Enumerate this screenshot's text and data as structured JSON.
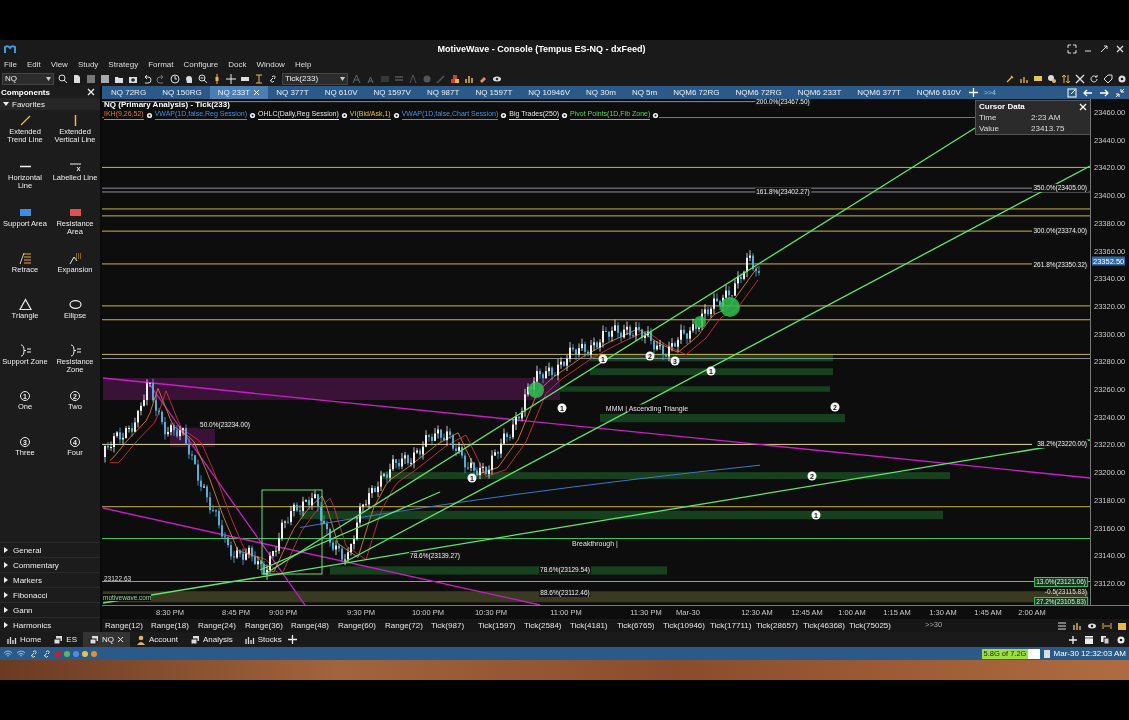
{
  "window": {
    "title": "MotiveWave - Console (Tempus ES-NQ - dxFeed)"
  },
  "menu": [
    "File",
    "Edit",
    "View",
    "Study",
    "Strategy",
    "Format",
    "Configure",
    "Dock",
    "Window",
    "Help"
  ],
  "toolbar": {
    "symbol": "NQ",
    "bar_size": "Tick(233)"
  },
  "chart_tabs": [
    {
      "label": "NQ 72RG",
      "selected": false
    },
    {
      "label": "NQ 150RG",
      "selected": false
    },
    {
      "label": "NQ 233T",
      "selected": true
    },
    {
      "label": "NQ 377T",
      "selected": false
    },
    {
      "label": "NQ 610V",
      "selected": false
    },
    {
      "label": "NQ 1597V",
      "selected": false
    },
    {
      "label": "NQ 987T",
      "selected": false
    },
    {
      "label": "NQ 1597T",
      "selected": false
    },
    {
      "label": "NQ 10946V",
      "selected": false
    },
    {
      "label": "NQ 30m",
      "selected": false
    },
    {
      "label": "NQ 5m",
      "selected": false
    },
    {
      "label": "NQM6 72RG",
      "selected": false
    },
    {
      "label": "NQM6 72RG",
      "selected": false
    },
    {
      "label": "NQM6 233T",
      "selected": false
    },
    {
      "label": "NQM6 377T",
      "selected": false
    },
    {
      "label": "NQM6 610V",
      "selected": false
    }
  ],
  "chart_tabs_overflow": ">>4",
  "components": {
    "title": "Components",
    "favorites": {
      "label": "Favorites",
      "expanded": true,
      "items": [
        {
          "label": "Extended Trend Line",
          "kind": "trend-line"
        },
        {
          "label": "Extended Vertical Line",
          "kind": "vertical-line"
        },
        {
          "label": "Horizontal Line",
          "kind": "horizontal-line"
        },
        {
          "label": "Labelled Line",
          "kind": "labelled-line"
        },
        {
          "label": "Support Area",
          "kind": "support-area"
        },
        {
          "label": "Resistance Area",
          "kind": "resistance-area"
        },
        {
          "label": "Retrace",
          "kind": "retrace"
        },
        {
          "label": "Expansion",
          "kind": "expansion"
        },
        {
          "label": "Triangle",
          "kind": "triangle"
        },
        {
          "label": "Ellipse",
          "kind": "ellipse"
        },
        {
          "label": "Support Zone",
          "kind": "zone"
        },
        {
          "label": "Resistance Zone",
          "kind": "zone"
        },
        {
          "label": "One",
          "kind": "number",
          "symbol": "1"
        },
        {
          "label": "Two",
          "kind": "number",
          "symbol": "2"
        },
        {
          "label": "Three",
          "kind": "number",
          "symbol": "3"
        },
        {
          "label": "Four",
          "kind": "number",
          "symbol": "4"
        }
      ]
    },
    "sections": [
      {
        "label": "General",
        "expanded": false
      },
      {
        "label": "Commentary",
        "expanded": false
      },
      {
        "label": "Markers",
        "expanded": false
      },
      {
        "label": "Fibonacci",
        "expanded": false
      },
      {
        "label": "Gann",
        "expanded": false
      },
      {
        "label": "Harmonics",
        "expanded": false
      }
    ]
  },
  "chart": {
    "title": "NQ (Primary Analysis) - Tick(233)",
    "studies": [
      {
        "label": "IKH(9,26,52)",
        "color": "#d9822b"
      },
      {
        "label": "VWAP(1D,false,Reg Session)",
        "color": "#4a8fe0"
      },
      {
        "label": "OHLC(Daily,Reg Session)",
        "color": "#e6e6e6"
      },
      {
        "label": "VI(Bid/Ask,1)",
        "color": "#e0c63a"
      },
      {
        "label": "VWAP(1D,false,Chart Session)",
        "color": "#4a8fe0"
      },
      {
        "label": "Big Trades(250)",
        "color": "#e6e6e6"
      },
      {
        "label": "Pivot Points(1D,Fib Zone)",
        "color": "#5fd35f"
      }
    ],
    "cursor_data": {
      "title": "Cursor Data",
      "rows": [
        {
          "label": "Time",
          "value": "2:23 AM"
        },
        {
          "label": "Value",
          "value": "23413.75"
        }
      ]
    },
    "level_labels": [
      {
        "text": "200.0%(23467.50)",
        "kind": "fib"
      },
      {
        "text": "161.8%(23402.27)",
        "kind": "fib"
      },
      {
        "text": "350.0%(23405.00)",
        "kind": "fib"
      },
      {
        "text": "300.0%(23374.00)",
        "kind": "fib"
      },
      {
        "text": "261.8%(23350.32)",
        "kind": "fib"
      },
      {
        "text": "38.2%(23220.00)",
        "kind": "fib"
      },
      {
        "text": "50.0%(23234.00)",
        "kind": "fib"
      },
      {
        "text": "78.6%(23139.27)",
        "kind": "fib"
      },
      {
        "text": "78.6%(23129.54)",
        "kind": "fib"
      },
      {
        "text": "88.6%(23112.46)",
        "kind": "fib"
      },
      {
        "text": "13.0%(23121.06)",
        "kind": "target"
      },
      {
        "text": "-0.5(23115.83)",
        "kind": "plain"
      },
      {
        "text": "27.2%(23105.83)",
        "kind": "target"
      },
      {
        "text": "23122.63",
        "kind": "plain"
      }
    ],
    "annotations": [
      "MMM | Ascending Triangle",
      "Breakthrough |"
    ],
    "wave_labels": [
      "1",
      "2",
      "3",
      "1",
      "1",
      "2",
      "2",
      "1",
      "1"
    ],
    "watermark": "motivewave.com",
    "price_axis": [
      "23460.00",
      "23440.00",
      "23420.00",
      "23400.00",
      "23380.00",
      "23360.00",
      "23340.00",
      "23320.00",
      "23300.00",
      "23280.00",
      "23260.00",
      "23240.00",
      "23220.00",
      "23200.00",
      "23180.00",
      "23160.00",
      "23140.00",
      "23120.00"
    ],
    "current_price": "23352.50",
    "time_axis": [
      "8:30 PM",
      "8:45 PM",
      "9:00 PM",
      "9:30 PM",
      "10:00 PM",
      "10:30 PM",
      "11:00 PM",
      "11:30 PM",
      "Mar-30",
      "12:30 AM",
      "12:45 AM",
      "1:00 AM",
      "1:15 AM",
      "1:30 AM",
      "1:45 AM",
      "2:00 AM"
    ]
  },
  "bar_periods": [
    "Range(12)",
    "Range(18)",
    "Range(24)",
    "Range(36)",
    "Range(48)",
    "Range(60)",
    "Range(72)",
    "Tick(987)",
    "Tick(1597)",
    "Tick(2584)",
    "Tick(4181)",
    "Tick(6765)",
    "Tick(10946)",
    "Tick(17711)",
    "Tick(28657)",
    "Tick(46368)",
    "Tick(75025)"
  ],
  "bar_periods_overflow": ">>30",
  "workspace_tabs": [
    {
      "label": "Home",
      "kind": "chart",
      "selected": false
    },
    {
      "label": "ES",
      "kind": "window",
      "selected": false
    },
    {
      "label": "NQ",
      "kind": "window",
      "selected": true
    },
    {
      "label": "Account",
      "kind": "person",
      "selected": false
    },
    {
      "label": "Analysis",
      "kind": "window",
      "selected": false
    },
    {
      "label": "Stocks",
      "kind": "chart",
      "selected": false
    }
  ],
  "status_bar": {
    "indicators": [
      {
        "color": "#c8202a"
      },
      {
        "color": "#5cb85c"
      },
      {
        "color": "#4a8fe0"
      },
      {
        "color": "#e8c440"
      },
      {
        "color": "#e8902a"
      }
    ],
    "memory": {
      "text": "5.8G of 7.2G",
      "level": 0.8
    },
    "datetime": "Mar-30 12:32:03 AM"
  }
}
